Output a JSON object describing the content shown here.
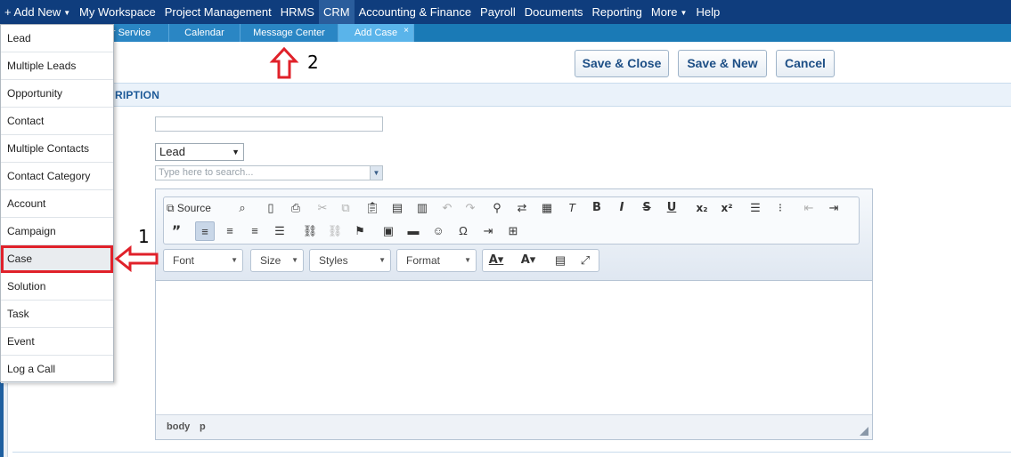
{
  "topnav": {
    "add_new": "+ Add New",
    "items": [
      "My Workspace",
      "Project Management",
      "HRMS",
      "CRM",
      "Accounting & Finance",
      "Payroll",
      "Documents",
      "Reporting",
      "More",
      "Help"
    ]
  },
  "subtabs": {
    "items": [
      "er Service",
      "Calendar",
      "Message Center",
      "Add Case"
    ],
    "close_glyph": "×"
  },
  "actions": {
    "save_close": "Save & Close",
    "save_new": "Save & New",
    "cancel": "Cancel"
  },
  "section": {
    "title": "RIPTION"
  },
  "form": {
    "related_type": "Lead",
    "search_placeholder": "Type here to search..."
  },
  "editor": {
    "source_label": "Source",
    "font_label": "Font",
    "size_label": "Size",
    "styles_label": "Styles",
    "format_label": "Format",
    "path": [
      "body",
      "p"
    ]
  },
  "dropdown": {
    "items": [
      "Lead",
      "Multiple Leads",
      "Opportunity",
      "Contact",
      "Multiple Contacts",
      "Contact Category",
      "Account",
      "Campaign",
      "Case",
      "Solution",
      "Task",
      "Event",
      "Log a Call"
    ],
    "highlighted": "Case"
  },
  "annotations": {
    "step1": "1",
    "step2": "2"
  },
  "colors": {
    "nav_bg": "#0f3d7d",
    "subtab_bg": "#1a7ab6",
    "highlight": "#e0212a",
    "accent_text": "#1d5a98"
  }
}
